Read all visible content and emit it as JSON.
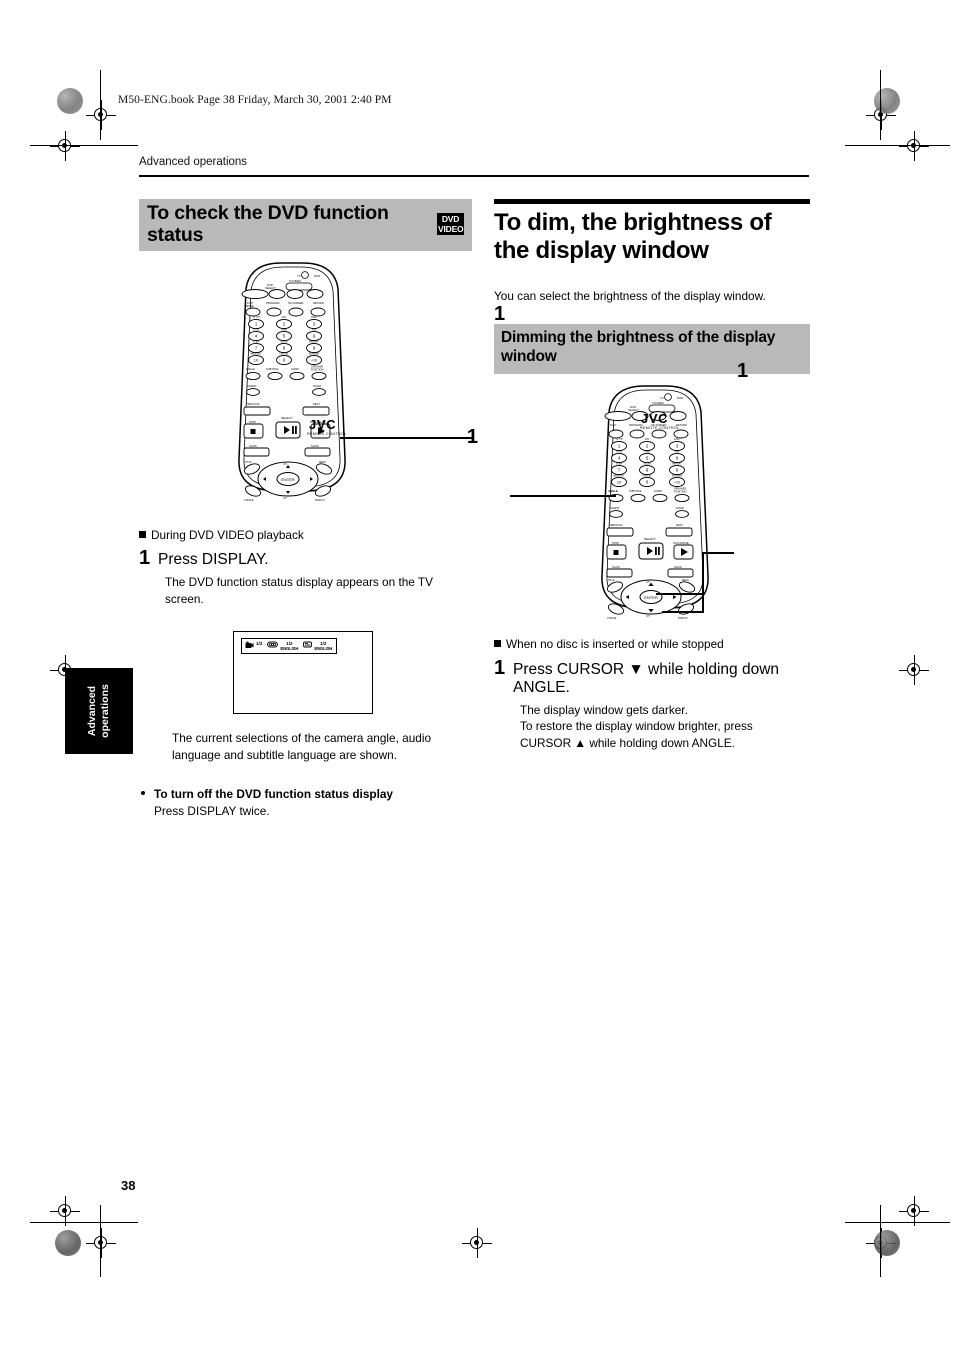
{
  "page": {
    "file_header": "M50-ENG.book  Page 38  Friday, March 30, 2001  2:40 PM",
    "running_head": "Advanced operations",
    "page_number": "38",
    "side_tab": "Advanced\noperations",
    "side_tab_line1": "Advanced",
    "side_tab_line2": "operations"
  },
  "colors": {
    "gray_bar": "#b9b9b9",
    "text": "#000000",
    "background": "#ffffff"
  },
  "left_column": {
    "heading": "To check the DVD function status",
    "badge": {
      "line1": "DVD",
      "line2": "VIDEO",
      "name": "dvd-video-badge"
    },
    "figure": {
      "brand": "JVC",
      "sublabel": "REMOTE CONTROL",
      "callout": "1"
    },
    "context_line": "During DVD VIDEO playback",
    "step": {
      "number": "1",
      "title": "Press DISPLAY.",
      "detail": "The DVD function status display appears on the TV screen."
    },
    "tv_figure": {
      "angle_fraction": "1/2",
      "audio_fraction": "1/2",
      "audio_language": "ENGLISH",
      "subtitle_fraction": "1/2",
      "subtitle_language": "ENGLISH"
    },
    "caption": "The current selections of the camera angle, audio language and subtitle language are shown.",
    "tip": {
      "title": "To turn off the DVD function status display",
      "body": "Press DISPLAY twice."
    }
  },
  "right_column": {
    "heading_line1": "To dim, the brightness of",
    "heading_line2": "the display window",
    "lead": "You can select the brightness of the display window.",
    "subheading": "Dimming the brightness of the display window",
    "figure": {
      "brand": "JVC",
      "sublabel": "REMOTE CONTROL",
      "callout_left": "1",
      "callout_right": "1"
    },
    "context_line": "When no disc is inserted or while stopped",
    "step": {
      "number": "1",
      "title_line1": "Press CURSOR ▼ while holding down",
      "title_line2": "ANGLE.",
      "detail_line1": "The display window gets darker.",
      "detail_line2": "To restore the display window brighter, press",
      "detail_line3": "CURSOR ▲ while holding down ANGLE."
    }
  }
}
